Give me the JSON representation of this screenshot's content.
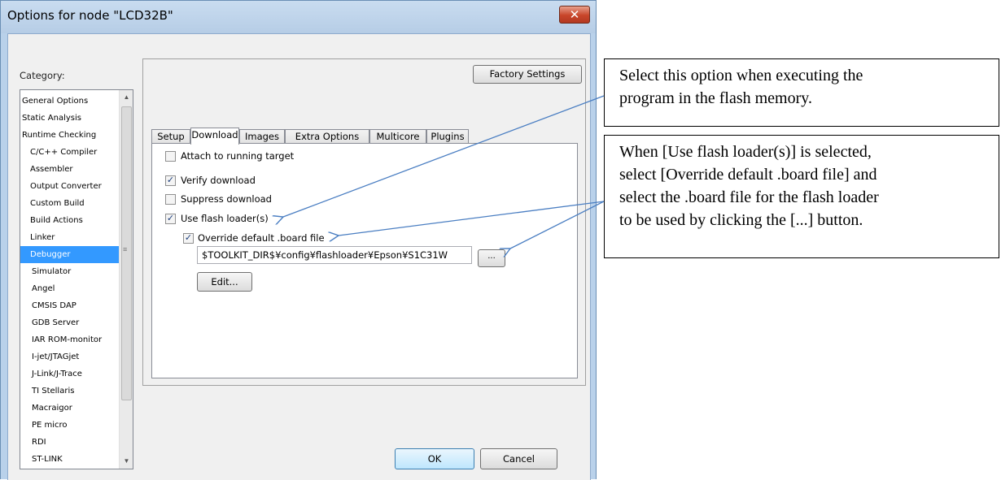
{
  "window": {
    "title": "Options for node \"LCD32B\"",
    "close_glyph": "✕"
  },
  "category": {
    "label": "Category:",
    "items": [
      {
        "label": "General Options",
        "level": "top"
      },
      {
        "label": "Static Analysis",
        "level": "top"
      },
      {
        "label": "Runtime Checking",
        "level": "top"
      },
      {
        "label": "C/C++ Compiler",
        "level": "sub"
      },
      {
        "label": "Assembler",
        "level": "top"
      },
      {
        "label": "Output Converter",
        "level": "top"
      },
      {
        "label": "Custom Build",
        "level": "top"
      },
      {
        "label": "Build Actions",
        "level": "top"
      },
      {
        "label": "Linker",
        "level": "top"
      },
      {
        "label": "Debugger",
        "level": "top",
        "selected": true
      },
      {
        "label": "Simulator",
        "level": "sub"
      },
      {
        "label": "Angel",
        "level": "sub"
      },
      {
        "label": "CMSIS DAP",
        "level": "sub"
      },
      {
        "label": "GDB Server",
        "level": "sub"
      },
      {
        "label": "IAR ROM-monitor",
        "level": "sub"
      },
      {
        "label": "I-jet/JTAGjet",
        "level": "sub"
      },
      {
        "label": "J-Link/J-Trace",
        "level": "sub"
      },
      {
        "label": "TI Stellaris",
        "level": "sub"
      },
      {
        "label": "Macraigor",
        "level": "sub"
      },
      {
        "label": "PE micro",
        "level": "sub"
      },
      {
        "label": "RDI",
        "level": "sub"
      },
      {
        "label": "ST-LINK",
        "level": "sub"
      }
    ]
  },
  "factory_settings_label": "Factory Settings",
  "tabs": [
    {
      "label": "Setup",
      "active": false
    },
    {
      "label": "Download",
      "active": true
    },
    {
      "label": "Images",
      "active": false
    },
    {
      "label": "Extra Options",
      "active": false
    },
    {
      "label": "Multicore",
      "active": false
    },
    {
      "label": "Plugins",
      "active": false
    }
  ],
  "download": {
    "attach": {
      "label": "Attach to running target",
      "checked": false
    },
    "verify": {
      "label": "Verify download",
      "checked": true
    },
    "suppress": {
      "label": "Suppress download",
      "checked": false
    },
    "use_flash": {
      "label": "Use flash loader(s)",
      "checked": true
    },
    "override": {
      "label": "Override default .board file",
      "checked": true
    },
    "board_path": "$TOOLKIT_DIR$¥config¥flashloader¥Epson¥S1C31W",
    "browse_label": "...",
    "edit_label": "Edit..."
  },
  "ok_label": "OK",
  "cancel_label": "Cancel",
  "callouts": {
    "first": [
      "Select this option when executing the",
      "program in the flash memory."
    ],
    "second": [
      "When [Use flash loader(s)] is selected,",
      "select [Override default .board file] and",
      "select the .board file for the flash loader",
      "to be used by clicking the [...] button."
    ]
  },
  "colors": {
    "selection": "#3399ff",
    "arrow": "#4a7ec2"
  }
}
